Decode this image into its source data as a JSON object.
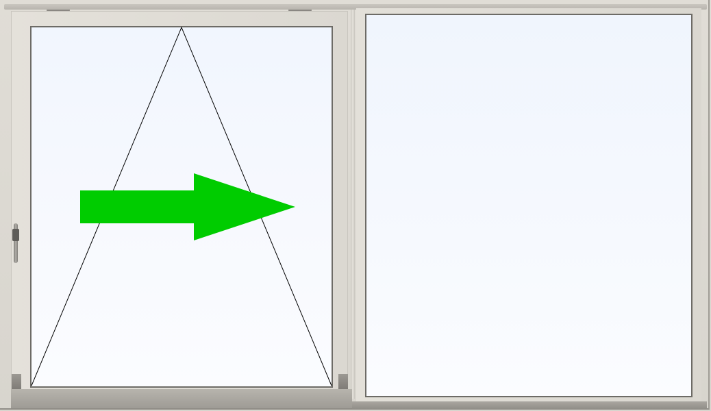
{
  "window": {
    "type": "sliding-door",
    "opening_direction": "right",
    "frame_color": "#dcd9d2",
    "glass_color": "#f4f8fe",
    "arrow_color": "#00cc00",
    "line_color": "#000000",
    "icons": [
      "top-handle-icon",
      "side-handle-icon",
      "opening-arrow-icon"
    ]
  }
}
